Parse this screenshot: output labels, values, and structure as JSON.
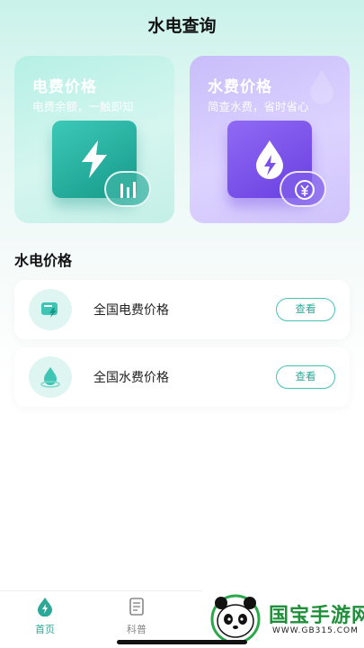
{
  "header": {
    "title": "水电查询"
  },
  "feature_cards": [
    {
      "title": "电费价格",
      "subtitle": "电费余额，一触即知",
      "accent": "#17998a",
      "icon": "lightning-icon"
    },
    {
      "title": "水费价格",
      "subtitle": "简查水费，省时省心",
      "accent": "#6a3fe0",
      "icon": "water-drop-icon"
    }
  ],
  "section": {
    "title": "水电价格"
  },
  "price_list": [
    {
      "label": "全国电费价格",
      "button": "查看",
      "icon": "electric-meter-icon"
    },
    {
      "label": "全国水费价格",
      "button": "查看",
      "icon": "water-drop-icon"
    }
  ],
  "tabbar": {
    "items": [
      {
        "label": "首页",
        "icon": "home-drop-icon",
        "active": true
      },
      {
        "label": "科普",
        "icon": "document-icon",
        "active": false
      }
    ]
  },
  "watermark": {
    "brand": "国宝手游网",
    "url": "WWW.GB315.COM"
  },
  "colors": {
    "primary": "#2ca898",
    "purple": "#6a3fe0",
    "background_top": "#c9f2ea"
  }
}
